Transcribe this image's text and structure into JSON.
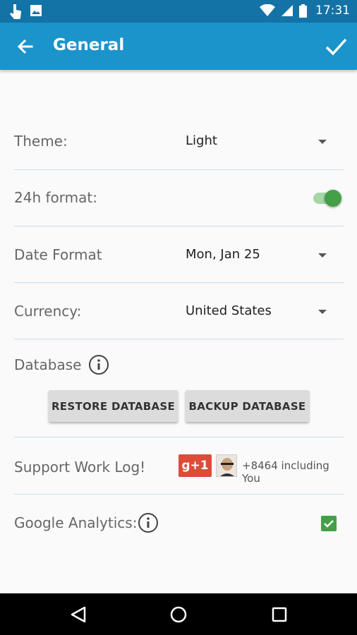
{
  "status_bar": {
    "time": "17:31",
    "left_icons": [
      "touch-icon",
      "image-icon"
    ],
    "right_icons": [
      "wifi-icon",
      "signal-icon",
      "battery-icon"
    ]
  },
  "app_bar": {
    "title": "General",
    "back_icon": "arrow-back-icon",
    "confirm_icon": "check-icon"
  },
  "settings": {
    "theme": {
      "label": "Theme:",
      "value": "Light"
    },
    "time_format": {
      "label": "24h format:",
      "enabled": true
    },
    "date_format": {
      "label": "Date Format",
      "value": "Mon, Jan 25"
    },
    "currency": {
      "label": "Currency:",
      "value": "United States"
    },
    "database": {
      "label": "Database",
      "restore_label": "RESTORE DATABASE",
      "backup_label": "BACKUP DATABASE"
    },
    "support": {
      "label": "Support Work Log!",
      "gplus_label": "g+1",
      "count_text": "+8464 including You"
    },
    "analytics": {
      "label": "Google Analytics:",
      "checked": true
    }
  },
  "colors": {
    "status_bar": "#1473a6",
    "app_bar": "#1b94cb",
    "accent_green": "#43a047",
    "divider": "#bfe0ee",
    "gplus_red": "#dd4b39"
  },
  "nav_bar": {
    "icons": [
      "back-triangle-icon",
      "home-circle-icon",
      "recents-square-icon"
    ]
  }
}
